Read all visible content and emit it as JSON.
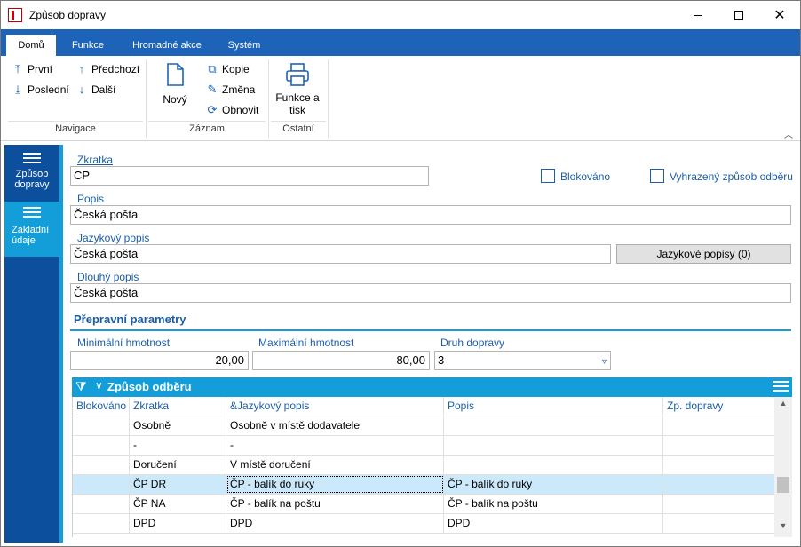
{
  "window": {
    "title": "Způsob dopravy",
    "icon": "app-logo-icon",
    "minimize": "—",
    "maximize": "☐",
    "close": "✕"
  },
  "ribbon_tabs": [
    "Domů",
    "Funkce",
    "Hromadné akce",
    "Systém"
  ],
  "ribbon": {
    "navigation": {
      "label": "Navigace",
      "first": "První",
      "previous": "Předchozí",
      "last": "Poslední",
      "next": "Další"
    },
    "record": {
      "label": "Záznam",
      "new": "Nový",
      "copy": "Kopie",
      "change": "Změna",
      "refresh": "Obnovit"
    },
    "other": {
      "label": "Ostatní",
      "print_line1": "Funkce a",
      "print_line2": "tisk"
    }
  },
  "leftnav": {
    "item1_line1": "Způsob",
    "item1_line2": "dopravy",
    "item2_line1": "Základní",
    "item2_line2": "údaje"
  },
  "form": {
    "zkratka_label": "Zkratka",
    "zkratka_value": "CP",
    "blokovano_label": "Blokováno",
    "vyhrazeny_label": "Vyhrazený způsob odběru",
    "popis_label": "Popis",
    "popis_value": "Česká pošta",
    "jazykovy_label": "Jazykový popis",
    "jazykovy_value": "Česká pošta",
    "jazykove_button": "Jazykové popisy (0)",
    "dlouhy_label": "Dlouhý popis",
    "dlouhy_value": "Česká pošta"
  },
  "params": {
    "title": "Přepravní parametry",
    "min_label": "Minimální hmotnost",
    "min_value": "20,00",
    "max_label": "Maximální hmotnost",
    "max_value": "80,00",
    "druh_label": "Druh dopravy",
    "druh_value": "3"
  },
  "grid": {
    "title": "Způsob odběru",
    "columns": [
      "Blokováno",
      "Zkratka",
      "&Jazykový popis",
      "Popis",
      "Zp. dopravy"
    ],
    "rows": [
      [
        "",
        "Osobně",
        "Osobně v místě dodavatele",
        "",
        ""
      ],
      [
        "",
        "-",
        "-",
        "",
        ""
      ],
      [
        "",
        "Doručení",
        "V místě doručení",
        "",
        ""
      ],
      [
        "",
        "ČP DR",
        "ČP - balík do ruky",
        "ČP - balík do ruky",
        ""
      ],
      [
        "",
        "ČP NA",
        "ČP - balík na poštu",
        "ČP - balík na poštu",
        ""
      ],
      [
        "",
        "DPD",
        "DPD",
        "DPD",
        ""
      ]
    ],
    "selected_row": 3
  }
}
